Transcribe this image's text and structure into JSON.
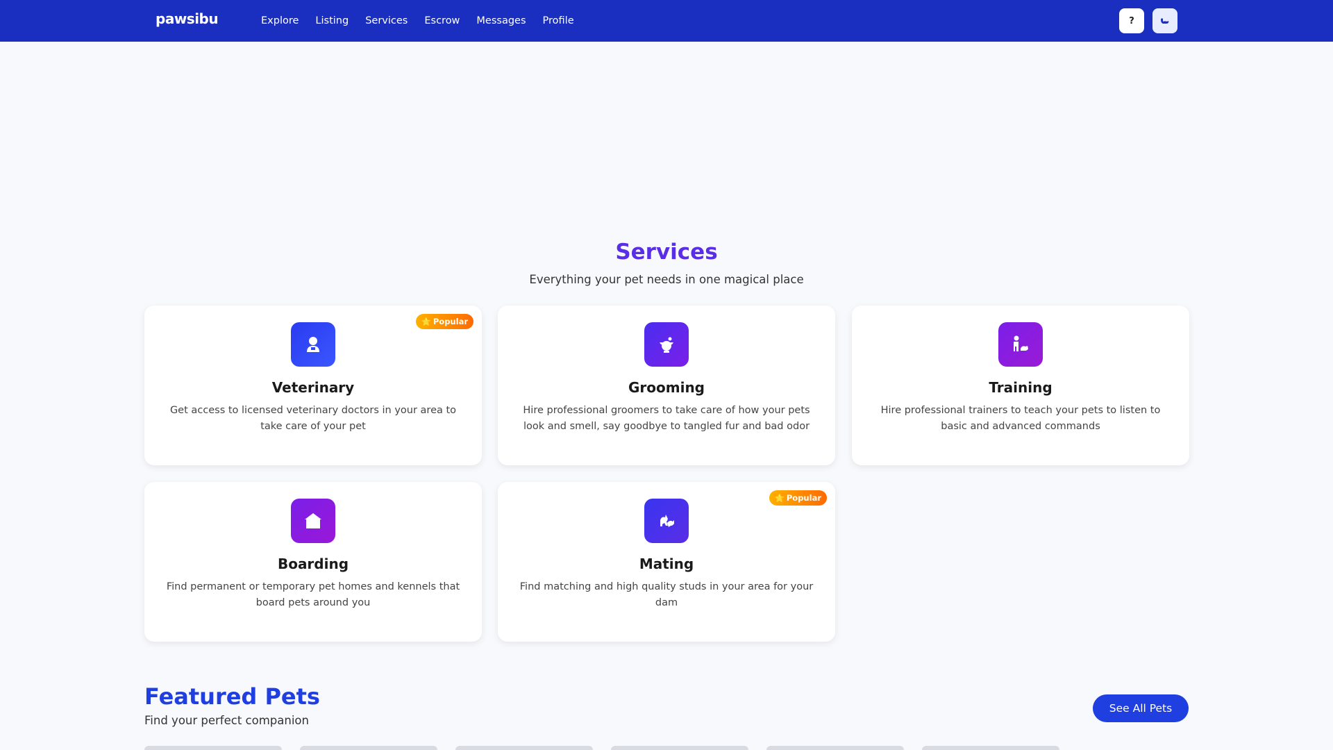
{
  "nav": {
    "logo": "pawsibu",
    "links": [
      "Explore",
      "Listing",
      "Services",
      "Escrow",
      "Messages",
      "Profile"
    ],
    "help_label": "?"
  },
  "services": {
    "title": "Services",
    "subtitle": "Everything your pet needs in one magical place",
    "cards": [
      {
        "title": "Veterinary",
        "description": "Get access to licensed veterinary doctors in your area to take care of your pet",
        "badge": "Popular",
        "icon": "veterinarian-icon"
      },
      {
        "title": "Grooming",
        "description": "Hire professional groomers to take care of how your pets look and smell, say goodbye to tangled fur and bad odor",
        "icon": "grooming-icon"
      },
      {
        "title": "Training",
        "description": "Hire professional trainers to teach your pets to listen to basic and advanced commands",
        "icon": "training-icon"
      },
      {
        "title": "Boarding",
        "description": "Find permanent or temporary pet homes and kennels that board pets around you",
        "icon": "house-icon"
      },
      {
        "title": "Mating",
        "description": "Find matching and high quality studs in your area for your dam",
        "badge": "Popular",
        "icon": "mating-icon"
      }
    ]
  },
  "featured": {
    "title": "Featured Pets",
    "subtitle": "Find your perfect companion",
    "see_all_label": "See All Pets"
  },
  "colors": {
    "nav_bg": "#1a2fc0",
    "accent_blue": "#1f3fe0",
    "accent_purple": "#5a2ee6",
    "badge_orange": "#ff8a00"
  }
}
